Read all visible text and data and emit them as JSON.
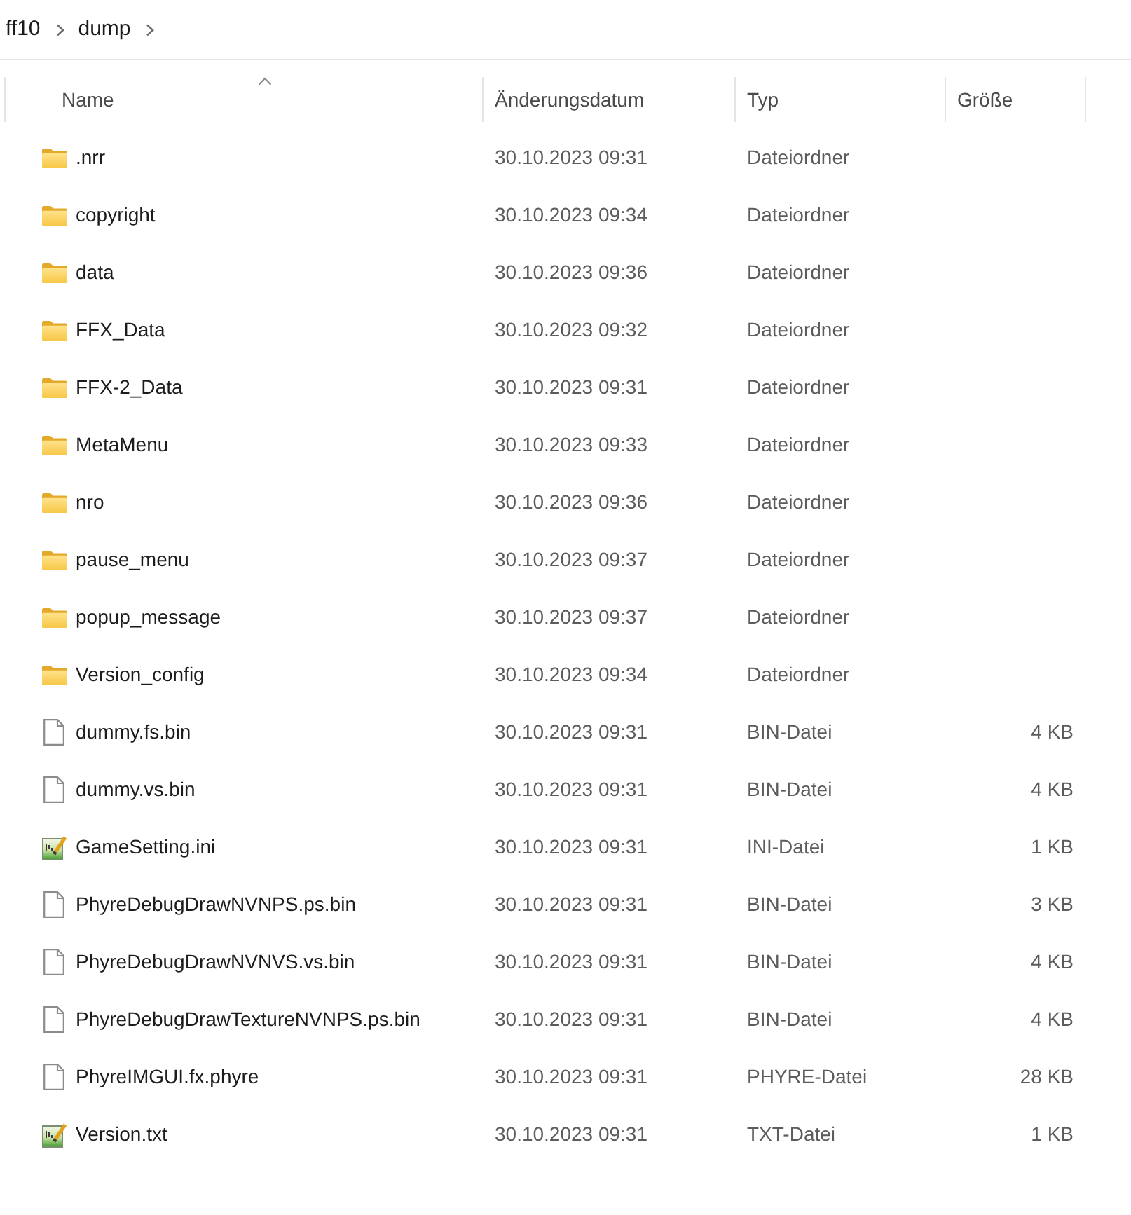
{
  "breadcrumb": [
    "ff10",
    "dump"
  ],
  "columns": [
    {
      "label": "Name",
      "sorted": true
    },
    {
      "label": "Änderungsdatum",
      "sorted": false
    },
    {
      "label": "Typ",
      "sorted": false
    },
    {
      "label": "Größe",
      "sorted": false
    }
  ],
  "rows": [
    {
      "kind": "folder",
      "name": ".nrr",
      "modified": "30.10.2023 09:31",
      "type": "Dateiordner"
    },
    {
      "kind": "folder",
      "name": "copyright",
      "modified": "30.10.2023 09:34",
      "type": "Dateiordner"
    },
    {
      "kind": "folder",
      "name": "data",
      "modified": "30.10.2023 09:36",
      "type": "Dateiordner"
    },
    {
      "kind": "folder",
      "name": "FFX_Data",
      "modified": "30.10.2023 09:32",
      "type": "Dateiordner"
    },
    {
      "kind": "folder",
      "name": "FFX-2_Data",
      "modified": "30.10.2023 09:31",
      "type": "Dateiordner"
    },
    {
      "kind": "folder",
      "name": "MetaMenu",
      "modified": "30.10.2023 09:33",
      "type": "Dateiordner"
    },
    {
      "kind": "folder",
      "name": "nro",
      "modified": "30.10.2023 09:36",
      "type": "Dateiordner"
    },
    {
      "kind": "folder",
      "name": "pause_menu",
      "modified": "30.10.2023 09:37",
      "type": "Dateiordner"
    },
    {
      "kind": "folder",
      "name": "popup_message",
      "modified": "30.10.2023 09:37",
      "type": "Dateiordner"
    },
    {
      "kind": "folder",
      "name": "Version_config",
      "modified": "30.10.2023 09:34",
      "type": "Dateiordner"
    },
    {
      "kind": "file",
      "name": "dummy.fs.bin",
      "modified": "30.10.2023 09:31",
      "type": "BIN-Datei",
      "size": "4 KB"
    },
    {
      "kind": "file",
      "name": "dummy.vs.bin",
      "modified": "30.10.2023 09:31",
      "type": "BIN-Datei",
      "size": "4 KB"
    },
    {
      "kind": "text",
      "name": "GameSetting.ini",
      "modified": "30.10.2023 09:31",
      "type": "INI-Datei",
      "size": "1 KB"
    },
    {
      "kind": "file",
      "name": "PhyreDebugDrawNVNPS.ps.bin",
      "modified": "30.10.2023 09:31",
      "type": "BIN-Datei",
      "size": "3 KB"
    },
    {
      "kind": "file",
      "name": "PhyreDebugDrawNVNVS.vs.bin",
      "modified": "30.10.2023 09:31",
      "type": "BIN-Datei",
      "size": "4 KB"
    },
    {
      "kind": "file",
      "name": "PhyreDebugDrawTextureNVNPS.ps.bin",
      "modified": "30.10.2023 09:31",
      "type": "BIN-Datei",
      "size": "4 KB"
    },
    {
      "kind": "file",
      "name": "PhyreIMGUI.fx.phyre",
      "modified": "30.10.2023 09:31",
      "type": "PHYRE-Datei",
      "size": "28 KB"
    },
    {
      "kind": "text",
      "name": "Version.txt",
      "modified": "30.10.2023 09:31",
      "type": "TXT-Datei",
      "size": "1 KB"
    }
  ]
}
